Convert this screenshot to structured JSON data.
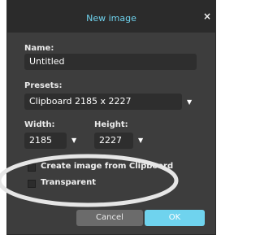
{
  "dialog": {
    "title": "New image",
    "close_glyph": "×",
    "accent_color": "#6fd3ee"
  },
  "name": {
    "label": "Name:",
    "value": "Untitled"
  },
  "presets": {
    "label": "Presets:",
    "value": "Clipboard 2185 x 2227"
  },
  "width": {
    "label": "Width:",
    "value": "2185"
  },
  "height": {
    "label": "Height:",
    "value": "2227"
  },
  "options": {
    "create_from_clipboard": {
      "label": "Create image from Clipboard",
      "checked": false
    },
    "transparent": {
      "label": "Transparent",
      "checked": false
    }
  },
  "buttons": {
    "cancel": "Cancel",
    "ok": "OK"
  },
  "icons": {
    "dropdown": "chevron-down-icon",
    "close": "close-icon"
  }
}
